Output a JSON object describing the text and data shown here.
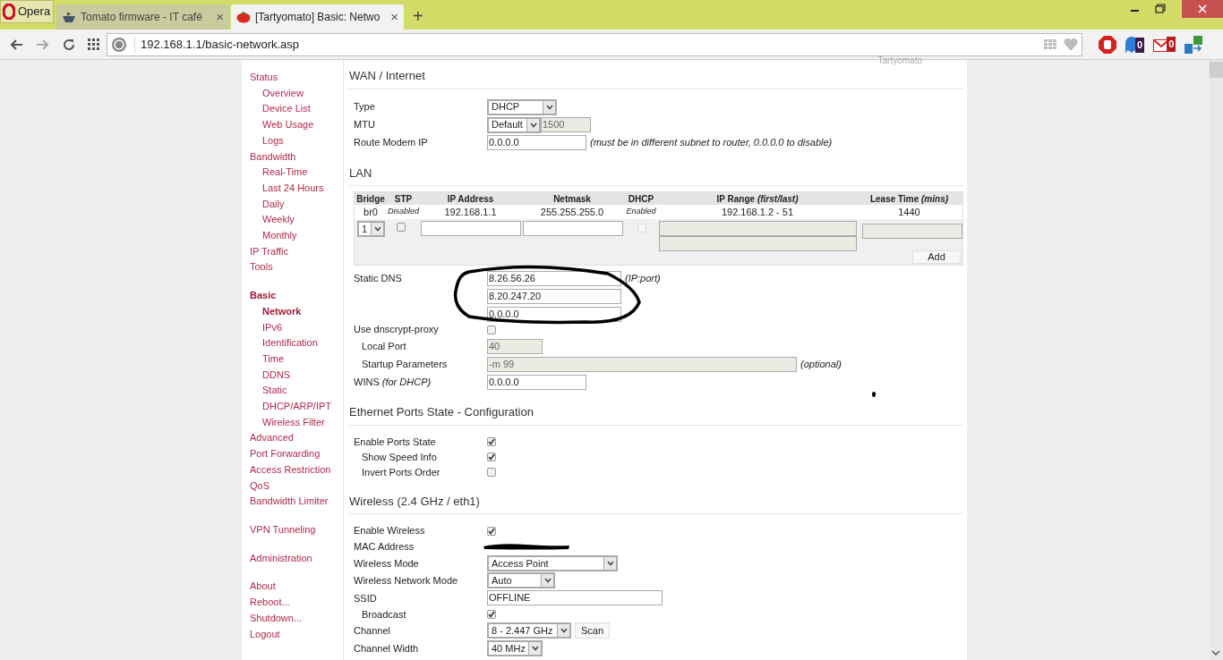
{
  "browser": {
    "menu_label": "Opera",
    "tabs": [
      {
        "title": "Tomato firmware - IT café",
        "selected": false,
        "close": "×"
      },
      {
        "title": "[Tartyomato] Basic: Netwo",
        "selected": true,
        "close": "×"
      }
    ],
    "new_tab": "+",
    "url": "192.168.1.1/basic-network.asp",
    "extension_badges": [
      "0",
      "0"
    ]
  },
  "router_name": "Tartyomato",
  "sidebar": [
    [
      {
        "label": "Status",
        "selected": false,
        "children": [
          {
            "label": "Overview",
            "selected": false
          },
          {
            "label": "Device List",
            "selected": false
          },
          {
            "label": "Web Usage",
            "selected": false
          },
          {
            "label": "Logs",
            "selected": false
          }
        ]
      },
      {
        "label": "Bandwidth",
        "selected": false,
        "children": [
          {
            "label": "Real-Time",
            "selected": false
          },
          {
            "label": "Last 24 Hours",
            "selected": false
          },
          {
            "label": "Daily",
            "selected": false
          },
          {
            "label": "Weekly",
            "selected": false
          },
          {
            "label": "Monthly",
            "selected": false
          }
        ]
      },
      {
        "label": "IP Traffic",
        "selected": false
      },
      {
        "label": "Tools",
        "selected": false
      }
    ],
    [
      {
        "label": "Basic",
        "selected": true,
        "children": [
          {
            "label": "Network",
            "selected": true
          },
          {
            "label": "IPv6",
            "selected": false
          },
          {
            "label": "Identification",
            "selected": false
          },
          {
            "label": "Time",
            "selected": false
          },
          {
            "label": "DDNS",
            "selected": false
          },
          {
            "label": "Static DHCP/ARP/IPT",
            "selected": false
          },
          {
            "label": "Wireless Filter",
            "selected": false
          }
        ]
      },
      {
        "label": "Advanced",
        "selected": false
      },
      {
        "label": "Port Forwarding",
        "selected": false
      },
      {
        "label": "Access Restriction",
        "selected": false
      },
      {
        "label": "QoS",
        "selected": false
      },
      {
        "label": "Bandwidth Limiter",
        "selected": false
      }
    ],
    [
      {
        "label": "VPN Tunneling",
        "selected": false
      }
    ],
    [
      {
        "label": "Administration",
        "selected": false
      }
    ],
    [
      {
        "label": "About",
        "selected": false
      },
      {
        "label": "Reboot...",
        "selected": false
      },
      {
        "label": "Shutdown...",
        "selected": false
      },
      {
        "label": "Logout",
        "selected": false
      }
    ]
  ],
  "sections": [
    {
      "title": "WAN / Internet",
      "rows": [
        {
          "kind": "select",
          "label": "Type",
          "indent": false,
          "value": "DHCP"
        },
        {
          "kind": "select_input",
          "label": "MTU",
          "indent": false,
          "value": "Default",
          "extra": "1500"
        },
        {
          "kind": "text",
          "label": "Route Modem IP",
          "indent": false,
          "value": "0.0.0.0",
          "note": "(must be in different subnet to router, 0.0.0.0 to disable)"
        }
      ]
    },
    {
      "title": "LAN",
      "lan": {
        "columns": [
          {
            "label": "Bridge",
            "kind": "text"
          },
          {
            "label": "STP",
            "kind": "state"
          },
          {
            "label": "IP Address",
            "kind": "text"
          },
          {
            "label": "Netmask",
            "kind": "text"
          },
          {
            "label": "DHCP",
            "kind": "state"
          },
          {
            "label": "IP Range *(first/last)*",
            "kind": "text"
          },
          {
            "label": "Lease Time *(mins)*",
            "kind": "text"
          }
        ],
        "row": [
          "br0",
          "Disabled",
          "192.168.1.1",
          "255.255.255.0",
          "Enabled",
          "192.168.1.2 - 51",
          "1440"
        ],
        "new_bridge": "1",
        "stp_checked": false,
        "dhcp_checked": false,
        "add": "Add"
      },
      "rows": [
        {
          "kind": "multi",
          "label": "Static DNS",
          "indent": false,
          "values": [
            "8.26.56.26",
            "8.20.247.20",
            "0.0.0.0"
          ],
          "note": "(IP:port)"
        },
        {
          "kind": "checkbox",
          "label": "Use dnscrypt-proxy",
          "indent": false,
          "checked": false
        },
        {
          "kind": "disabled_text",
          "label": "Local Port",
          "indent": true,
          "value": "40"
        },
        {
          "kind": "disabled_text",
          "label": "Startup Parameters",
          "indent": true,
          "value": "-m 99",
          "note": "(optional)"
        },
        {
          "kind": "text",
          "label": "WINS *(for DHCP)*",
          "indent": false,
          "value": "0.0.0.0"
        }
      ]
    },
    {
      "title": "Ethernet Ports State - Configuration",
      "rows": [
        {
          "kind": "checkbox",
          "label": "Enable Ports State",
          "indent": false,
          "checked": true
        },
        {
          "kind": "checkbox",
          "label": "Show Speed Info",
          "indent": true,
          "checked": true
        },
        {
          "kind": "checkbox",
          "label": "Invert Ports Order",
          "indent": true,
          "checked": false
        }
      ]
    },
    {
      "title": "Wireless (2.4 GHz / eth1)",
      "rows": [
        {
          "kind": "checkbox",
          "label": "Enable Wireless",
          "indent": false,
          "checked": true
        },
        {
          "kind": "redacted",
          "label": "MAC Address",
          "indent": false
        },
        {
          "kind": "select",
          "label": "Wireless Mode",
          "indent": false,
          "value": "Access Point"
        },
        {
          "kind": "select",
          "label": "Wireless Network Mode",
          "indent": false,
          "value": "Auto"
        },
        {
          "kind": "text",
          "label": "SSID",
          "indent": false,
          "value": "OFFLINE"
        },
        {
          "kind": "checkbox",
          "label": "Broadcast",
          "indent": true,
          "checked": true
        },
        {
          "kind": "select_button",
          "label": "Channel",
          "indent": false,
          "value": "8 - 2.447 GHz",
          "button": "Scan"
        },
        {
          "kind": "select",
          "label": "Channel Width",
          "indent": false,
          "value": "40 MHz"
        }
      ]
    }
  ]
}
